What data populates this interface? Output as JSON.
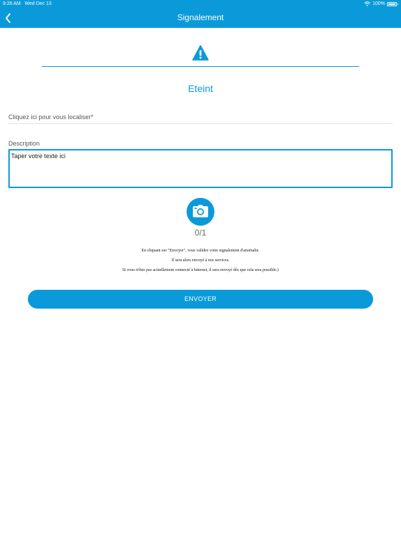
{
  "status_bar": {
    "time": "9:26 AM",
    "date": "Wed Dec 13",
    "battery": "100%",
    "battery_level": 1.0
  },
  "nav": {
    "title": "Signalement",
    "back_icon": "chevron-left-icon"
  },
  "header": {
    "warning_icon": "warning-icon",
    "category": "Eteint"
  },
  "form": {
    "locate_label": "Cliquez ici pour vous localiser*",
    "description_label": "Description",
    "description_placeholder": "Taper votre texte ici",
    "description_value": ""
  },
  "photo": {
    "camera_icon": "camera-icon",
    "counter": "0/1"
  },
  "notice": {
    "line1": "En cliquant sur \"Envoyer\", vous validez votre signalement d'anomalie.",
    "line2": "Il sera alors envoyé à nos services.",
    "line3": "Si vous n'êtes pas actuellement connecté à Internet, il sera envoyé dès que cela sera possible.)"
  },
  "actions": {
    "send_label": "ENVOYER"
  },
  "colors": {
    "accent": "#0a9ad9",
    "background": "#ffffff"
  }
}
